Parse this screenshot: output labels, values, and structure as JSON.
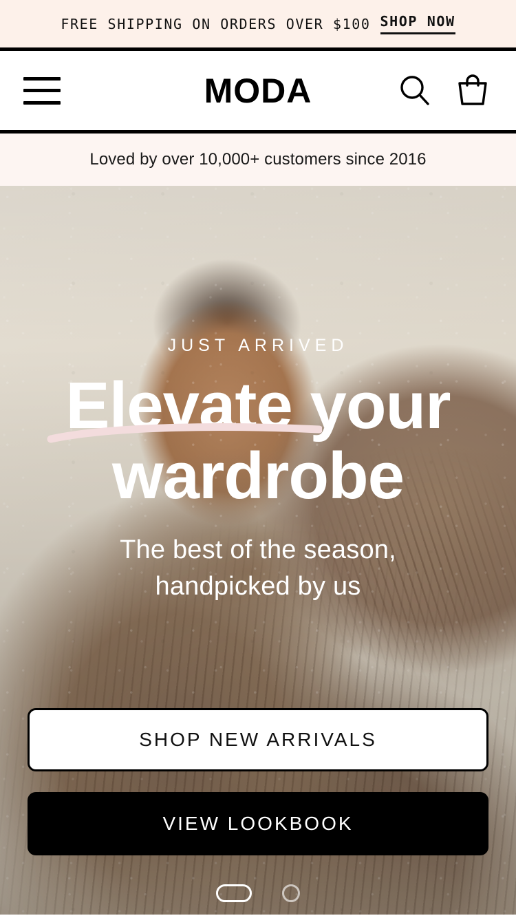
{
  "announcement": {
    "text": "FREE SHIPPING ON ORDERS OVER $100",
    "link_label": "SHOP NOW"
  },
  "header": {
    "menu_icon": "hamburger-menu-icon",
    "logo": "MODA",
    "search_icon": "search-icon",
    "cart_icon": "shopping-bag-icon"
  },
  "trustbar": {
    "text": "Loved by over 10,000+ customers since 2016"
  },
  "hero": {
    "eyebrow": "JUST ARRIVED",
    "headline_line1_highlight": "Elevate",
    "headline_line1_rest": " your",
    "headline_line2": "wardrobe",
    "subhead_line1": "The best of the season,",
    "subhead_line2": "handpicked by us",
    "primary_cta": "SHOP NEW ARRIVALS",
    "secondary_cta": "VIEW LOOKBOOK",
    "underline_color": "#f3dcdd"
  },
  "system_nav": {
    "home_indicator": "home-pill-indicator",
    "back_indicator": "circle-indicator"
  },
  "colors": {
    "announce_bg": "#fdf1ea",
    "trustbar_bg": "#fdf5f2",
    "ink": "#000000",
    "on_dark": "#ffffff"
  }
}
